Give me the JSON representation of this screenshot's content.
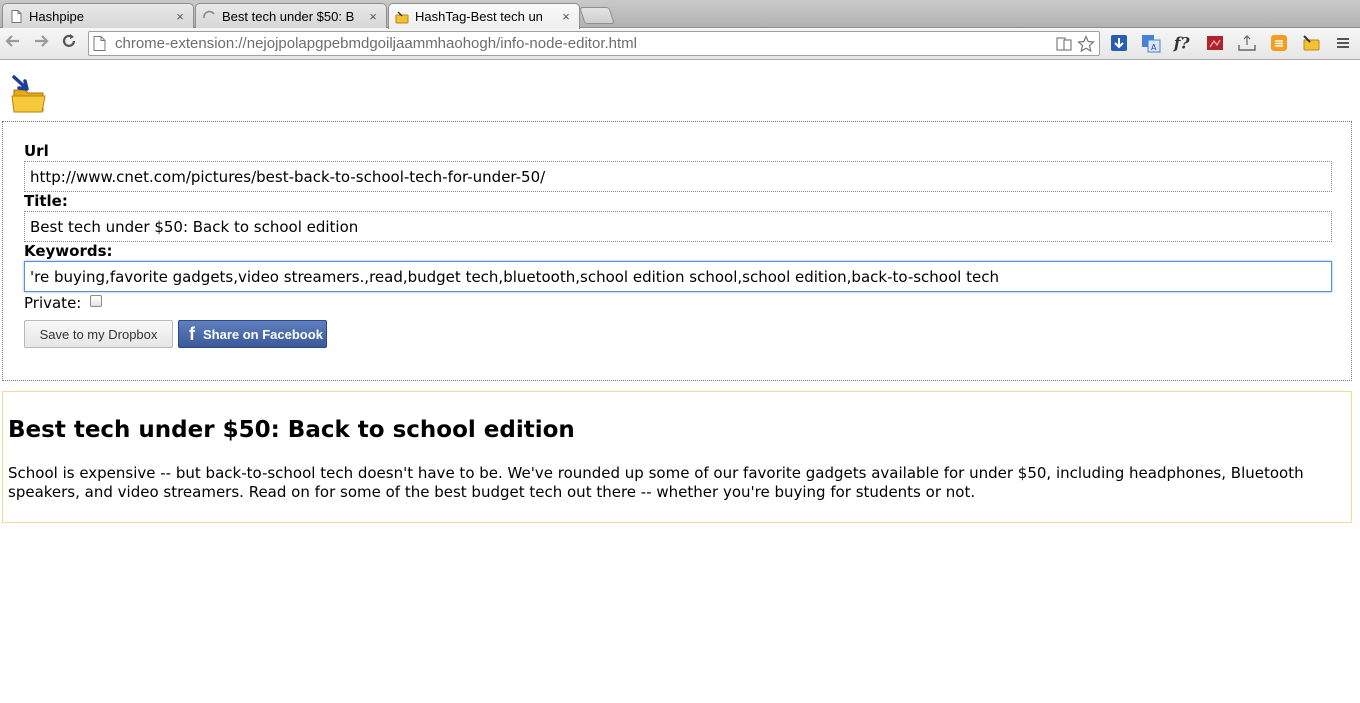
{
  "browser": {
    "tabs": [
      {
        "title": "Hashpipe",
        "icon": "page-icon",
        "active": false
      },
      {
        "title": "Best tech under $50: B",
        "icon": "loading-spinner-icon",
        "active": false
      },
      {
        "title": "HashTag-Best tech un",
        "icon": "extension-icon",
        "active": true
      }
    ],
    "tab_close": "×",
    "url": "chrome-extension://nejojpolapgpebmdgoiljaammhaohogh/info-node-editor.html"
  },
  "editor": {
    "url_label": "Url",
    "url_value": "http://www.cnet.com/pictures/best-back-to-school-tech-for-under-50/",
    "title_label": "Title:",
    "title_value": "Best tech under $50: Back to school edition",
    "keywords_label": "Keywords:",
    "keywords_value": "'re buying,favorite gadgets,video streamers.,read,budget tech,bluetooth,school edition school,school edition,back-to-school tech",
    "private_label": "Private:",
    "private_checked": false,
    "dropbox_button": "Save to my Dropbox",
    "facebook_button": "Share on Facebook"
  },
  "preview": {
    "title": "Best tech under $50: Back to school edition",
    "description": "School is expensive -- but back-to-school tech doesn't have to be. We've rounded up some of our favorite gadgets available for under $50, including headphones, Bluetooth speakers, and video streamers. Read on for some of the best budget tech out there -- whether you're buying for students or not."
  },
  "colors": {
    "facebook_blue": "#3b5998",
    "preview_border": "#f0dc9a",
    "focus_border": "#5a8fdb"
  }
}
